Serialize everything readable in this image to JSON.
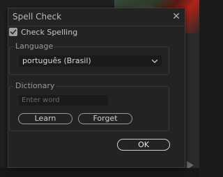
{
  "dialog": {
    "title": "Spell Check",
    "close_glyph": "✕"
  },
  "check_spelling": {
    "label": "Check Spelling",
    "checked": true
  },
  "language": {
    "group_label": "Language",
    "selected": "português (Brasil)"
  },
  "dictionary": {
    "group_label": "Dictionary",
    "input_placeholder": "Enter word",
    "input_value": "",
    "learn_label": "Learn",
    "forget_label": "Forget"
  },
  "footer": {
    "ok_label": "OK"
  },
  "icons": {
    "close": "close-icon",
    "checkmark": "checkmark-icon",
    "dropdown": "chevron-down-icon",
    "play": "play-icon"
  },
  "colors": {
    "dialog_bg": "#232323",
    "input_bg": "#1a1a1a",
    "text": "#c6c6c6",
    "border": "#3a3a3a"
  }
}
